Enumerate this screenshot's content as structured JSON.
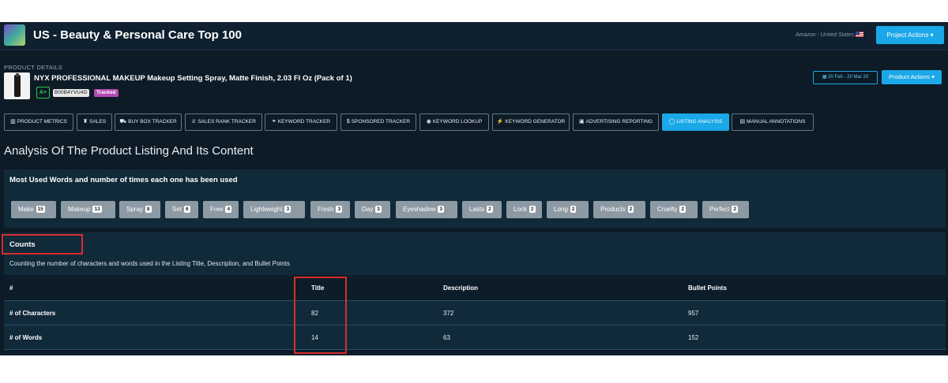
{
  "header": {
    "title": "US - Beauty & Personal Care Top 100",
    "marketplace": "Amazon - United States",
    "project_actions": "Project Actions ▾"
  },
  "product": {
    "section_label": "PRODUCT DETAILS",
    "title": "NYX PROFESSIONAL MAKEUP Makeup Setting Spray, Matte Finish, 2.03 Fl Oz (Pack of 1)",
    "grade": "A+",
    "asin": "B00B4YVU4G",
    "status": "Tracked",
    "date_range": "20 Feb - 20 Mar 20",
    "actions": "Product Actions ▾"
  },
  "tabs": [
    {
      "label": "PRODUCT METRICS",
      "icon": "chart-icon"
    },
    {
      "label": "SALES",
      "icon": "bag-icon"
    },
    {
      "label": "BUY BOX TRACKER",
      "icon": "cart-icon"
    },
    {
      "label": "SALES RANK TRACKER",
      "icon": "trophy-icon"
    },
    {
      "label": "KEYWORD TRACKER",
      "icon": "binoculars-icon"
    },
    {
      "label": "SPONSORED TRACKER",
      "icon": "dollar-icon"
    },
    {
      "label": "KEYWORD LOOKUP",
      "icon": "eye-icon"
    },
    {
      "label": "KEYWORD GENERATOR",
      "icon": "wand-icon"
    },
    {
      "label": "ADVERTISING REPORTING",
      "icon": "report-icon"
    },
    {
      "label": "LISTING ANALYSIS",
      "icon": "comment-icon",
      "active": true
    },
    {
      "label": "MANUAL ANNOTATIONS",
      "icon": "note-icon"
    }
  ],
  "page_title": "Analysis Of The Product Listing And Its Content",
  "words": {
    "heading": "Most Used Words and number of times each one has been used",
    "items": [
      {
        "word": "Make",
        "count": "15"
      },
      {
        "word": "Makeup",
        "count": "13"
      },
      {
        "word": "Spray",
        "count": "8"
      },
      {
        "word": "Set",
        "count": "6"
      },
      {
        "word": "Free",
        "count": "4"
      },
      {
        "word": "Lightweight",
        "count": "3"
      },
      {
        "word": "Fresh",
        "count": "3"
      },
      {
        "word": "Day",
        "count": "3"
      },
      {
        "word": "Eyeshadow",
        "count": "3"
      },
      {
        "word": "Lasts",
        "count": "2"
      },
      {
        "word": "Lock",
        "count": "2"
      },
      {
        "word": "Long",
        "count": "2"
      },
      {
        "word": "Products",
        "count": "2"
      },
      {
        "word": "Cruelty",
        "count": "2"
      },
      {
        "word": "Perfect",
        "count": "2"
      }
    ]
  },
  "counts": {
    "heading": "Counts",
    "description": "Counting the number of characters and words used in the Listing Title, Description, and Bullet Points",
    "columns": [
      "#",
      "Title",
      "Description",
      "Bullet Points"
    ],
    "rows": [
      [
        "# of Characters",
        "82",
        "372",
        "957"
      ],
      [
        "# of Words",
        "14",
        "63",
        "152"
      ]
    ]
  },
  "colors": {
    "background": "#0d1b26",
    "panel": "#112a3a",
    "accent": "#1ba8e8",
    "highlight": "#d92d2d"
  }
}
